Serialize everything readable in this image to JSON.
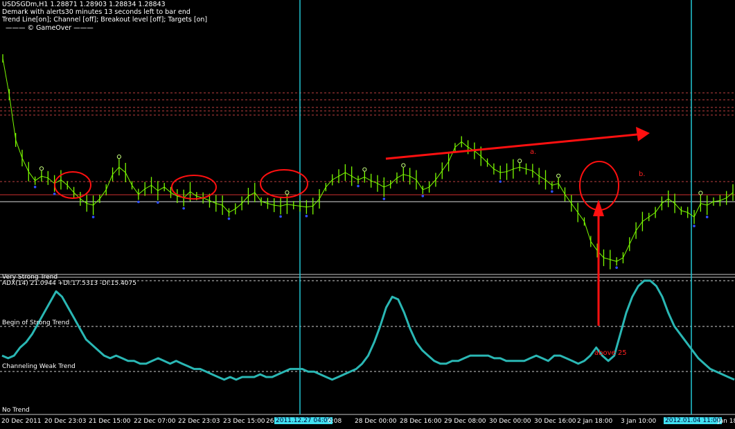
{
  "header": {
    "symbol_line": "USDSGDm,H1  1.28871 1.28903 1.28834 1.28843",
    "demark_line": "Demark with alerts30 minutes 13 seconds left to bar end",
    "settings_line": "Trend Line[on]; Channel [off]; Breakout level [off]; Targets [on]",
    "credit_line": "——— © GameOver ———"
  },
  "indicator": {
    "title": "ADX(14) 21.0944 +DI:17.5313 -DI:15.4075",
    "levels": [
      {
        "label": "Very Strong Trend",
        "value": 50
      },
      {
        "label": "Begin of Strong Trend",
        "value": 35
      },
      {
        "label": "Channeling Weak Trend",
        "value": 20
      },
      {
        "label": "No Trend",
        "value": 0
      }
    ]
  },
  "annotations": {
    "a": "a.",
    "b": "b.",
    "above": "above 25"
  },
  "colors": {
    "background": "#000000",
    "price": "#7cfc00",
    "adx": "#2ab7b4",
    "annotation": "#ff2020",
    "vline": "#22c7d6",
    "dashed": "#c04040",
    "swing_high": "#c8ff80",
    "swing_low": "#3050ff"
  },
  "chart_data": [
    {
      "type": "line",
      "series": [
        {
          "values": [
            1.296,
            1.292,
            1.287,
            1.285,
            1.2835,
            1.2825,
            1.283,
            1.2828,
            1.2822,
            1.2826,
            1.282,
            1.2812,
            1.2805,
            1.28,
            1.2798,
            1.2805,
            1.2815,
            1.2832,
            1.284,
            1.2834,
            1.282,
            1.281,
            1.2816,
            1.282,
            1.2814,
            1.2818,
            1.2812,
            1.2808,
            1.2806,
            1.2813,
            1.2808,
            1.2806,
            1.2803,
            1.28,
            1.2798,
            1.279,
            1.2794,
            1.28,
            1.2808,
            1.2812,
            1.2802,
            1.28,
            1.2798,
            1.2797,
            1.2799,
            1.2798,
            1.2797,
            1.2796,
            1.2797,
            1.2805,
            1.2818,
            1.2826,
            1.283,
            1.2834,
            1.283,
            1.2826,
            1.2829,
            1.2825,
            1.2822,
            1.2818,
            1.2821,
            1.2828,
            1.2832,
            1.283,
            1.2826,
            1.2815,
            1.2818,
            1.2826,
            1.2836,
            1.2846,
            1.2862,
            1.2868,
            1.2862,
            1.2858,
            1.2852,
            1.2845,
            1.2838,
            1.2834,
            1.2835,
            1.2838,
            1.284,
            1.2838,
            1.2836,
            1.283,
            1.2826,
            1.282,
            1.2822,
            1.281,
            1.28,
            1.279,
            1.278,
            1.2758,
            1.2748,
            1.274,
            1.2738,
            1.2736,
            1.274,
            1.2755,
            1.277,
            1.278,
            1.2785,
            1.279,
            1.28,
            1.2805,
            1.28,
            1.2792,
            1.279,
            1.2785,
            1.28,
            1.2798,
            1.2802,
            1.2803,
            1.2806,
            1.2812
          ]
        }
      ],
      "categories": [
        "20 Dec 2011",
        "20 Dec 23:03",
        "21 Dec 15:00",
        "22 Dec 07:00",
        "22 Dec 23:03",
        "23 Dec 15:00",
        "26",
        "2011.12.27 04:00",
        "6:08",
        "28 Dec 00:00",
        "28 Dec 16:00",
        "29 Dec 08:00",
        "30 Dec 00:00",
        "30 Dec 16:00",
        "2 Jan 18:00",
        "3 Jan 10:00",
        "2012.01.04 11:00",
        "Jan 18:"
      ],
      "ylim": [
        1.273,
        1.299
      ]
    },
    {
      "type": "line",
      "series": [
        {
          "values": [
            22,
            21,
            22,
            25,
            27,
            30,
            34,
            38,
            42,
            46,
            44,
            40,
            36,
            32,
            28,
            26,
            24,
            22,
            21,
            22,
            21,
            20,
            20,
            19,
            19,
            20,
            21,
            20,
            19,
            20,
            19,
            18,
            17,
            17,
            16,
            15,
            14,
            13,
            14,
            13,
            14,
            14,
            14,
            15,
            14,
            14,
            15,
            16,
            17,
            17,
            17,
            16,
            16,
            15,
            14,
            13,
            14,
            15,
            16,
            17,
            19,
            22,
            27,
            33,
            40,
            44,
            43,
            38,
            32,
            27,
            24,
            22,
            20,
            19,
            19,
            20,
            20,
            21,
            22,
            22,
            22,
            22,
            21,
            21,
            20,
            20,
            20,
            20,
            21,
            22,
            21,
            20,
            22,
            22,
            21,
            20,
            19,
            20,
            22,
            25,
            22,
            20,
            22,
            30,
            38,
            44,
            48,
            50,
            50,
            48,
            44,
            38,
            33,
            30,
            27,
            24,
            21,
            19,
            17,
            16,
            15,
            14,
            13
          ]
        }
      ],
      "ylim": [
        0,
        50
      ]
    }
  ]
}
